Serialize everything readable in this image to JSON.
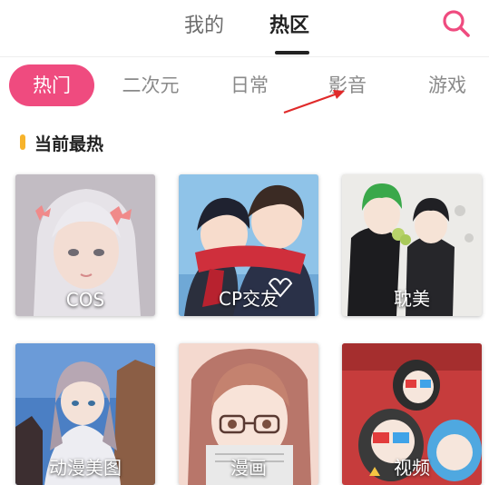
{
  "header": {
    "tabs": [
      {
        "label": "我的",
        "active": false
      },
      {
        "label": "热区",
        "active": true
      }
    ],
    "search_icon": "search-icon",
    "accent_color": "#ef4b7f"
  },
  "categories": [
    {
      "label": "热门",
      "active": true
    },
    {
      "label": "二次元",
      "active": false
    },
    {
      "label": "日常",
      "active": false
    },
    {
      "label": "影音",
      "active": false
    },
    {
      "label": "游戏",
      "active": false
    }
  ],
  "section": {
    "title": "当前最热",
    "marker_color": "#f7b32b"
  },
  "cards": [
    {
      "label": "COS"
    },
    {
      "label": "CP交友"
    },
    {
      "label": "耽美"
    },
    {
      "label": "动漫美图"
    },
    {
      "label": "漫画"
    },
    {
      "label": "视频"
    }
  ]
}
